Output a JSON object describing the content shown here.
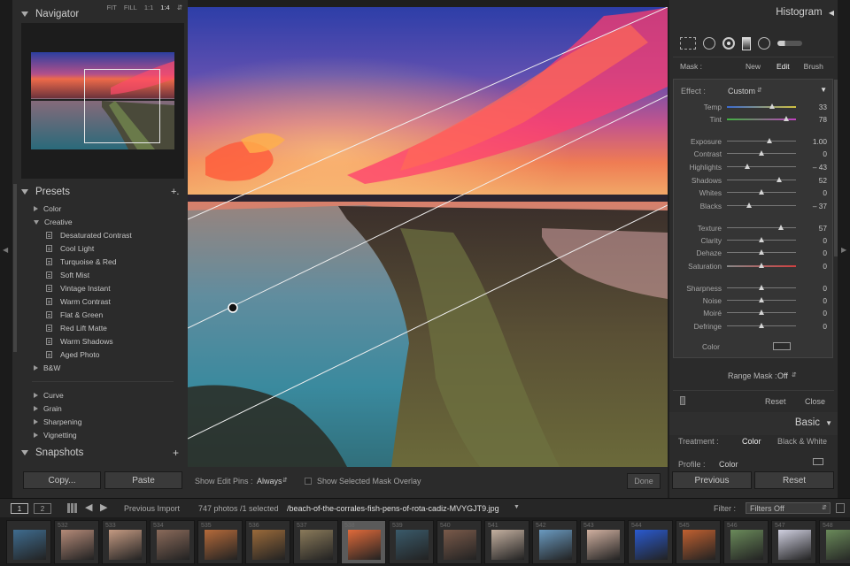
{
  "navigator": {
    "title": "Navigator",
    "zoom_options": [
      "FIT",
      "FILL",
      "1:1",
      "1:4"
    ],
    "selected_zoom": "1:4"
  },
  "presets": {
    "title": "Presets",
    "add": "+.",
    "folders": [
      {
        "label": "Color",
        "expanded": false
      },
      {
        "label": "Creative",
        "expanded": true
      },
      {
        "label": "B&W",
        "expanded": false
      }
    ],
    "creative_items": [
      "Desaturated Contrast",
      "Cool Light",
      "Turquoise & Red",
      "Soft Mist",
      "Vintage Instant",
      "Warm Contrast",
      "Flat & Green",
      "Red Lift Matte",
      "Warm Shadows",
      "Aged Photo"
    ],
    "groups": [
      "Curve",
      "Grain",
      "Sharpening",
      "Vignetting"
    ]
  },
  "snapshots": {
    "title": "Snapshots",
    "add": "+"
  },
  "left_buttons": {
    "copy": "Copy...",
    "paste": "Paste"
  },
  "toolbar": {
    "pins_label": "Show Edit Pins :",
    "pins_value": "Always",
    "overlay_label": "Show Selected Mask Overlay",
    "done": "Done"
  },
  "histogram": {
    "title": "Histogram"
  },
  "mask": {
    "label": "Mask :",
    "new": "New",
    "edit": "Edit",
    "brush": "Brush"
  },
  "effect": {
    "label": "Effect :",
    "value": "Custom"
  },
  "sliders": [
    {
      "label": "Temp",
      "value": "33",
      "pos": 0.65,
      "kind": "temp"
    },
    {
      "label": "Tint",
      "value": "78",
      "pos": 0.86,
      "kind": "tint"
    },
    {
      "label": "Exposure",
      "value": "1.00",
      "pos": 0.62
    },
    {
      "label": "Contrast",
      "value": "0",
      "pos": 0.5
    },
    {
      "label": "Highlights",
      "value": "– 43",
      "pos": 0.29
    },
    {
      "label": "Shadows",
      "value": "52",
      "pos": 0.76
    },
    {
      "label": "Whites",
      "value": "0",
      "pos": 0.5
    },
    {
      "label": "Blacks",
      "value": "– 37",
      "pos": 0.32
    },
    {
      "label": "Texture",
      "value": "57",
      "pos": 0.78
    },
    {
      "label": "Clarity",
      "value": "0",
      "pos": 0.5
    },
    {
      "label": "Dehaze",
      "value": "0",
      "pos": 0.5
    },
    {
      "label": "Saturation",
      "value": "0",
      "pos": 0.5,
      "kind": "sat"
    },
    {
      "label": "Sharpness",
      "value": "0",
      "pos": 0.5
    },
    {
      "label": "Noise",
      "value": "0",
      "pos": 0.5
    },
    {
      "label": "Moiré",
      "value": "0",
      "pos": 0.5
    },
    {
      "label": "Defringe",
      "value": "0",
      "pos": 0.5
    }
  ],
  "color_label": "Color",
  "range_mask": {
    "label": "Range Mask :",
    "value": "Off"
  },
  "mask_buttons": {
    "reset": "Reset",
    "close": "Close"
  },
  "basic": {
    "title": "Basic",
    "treatment_label": "Treatment :",
    "color": "Color",
    "bw": "Black & White",
    "profile_label": "Profile :",
    "profile_value": "Color"
  },
  "right_buttons": {
    "previous": "Previous",
    "reset": "Reset"
  },
  "filmstrip_bar": {
    "screen1": "1",
    "screen2": "2",
    "source": "Previous Import",
    "count": "747 photos /1 selected",
    "filename": "/beach-of-the-corrales-fish-pens-of-rota-cadiz-MVYGJT9.jpg",
    "filter_label": "Filter :",
    "filter_value": "Filters Off"
  },
  "filmstrip": [
    {
      "num": "",
      "hue": "#3f6c8f"
    },
    {
      "num": "532",
      "hue": "#b48a78"
    },
    {
      "num": "533",
      "hue": "#c49a82"
    },
    {
      "num": "534",
      "hue": "#8a6a5a"
    },
    {
      "num": "535",
      "hue": "#b56a3a"
    },
    {
      "num": "536",
      "hue": "#9a6a3a"
    },
    {
      "num": "537",
      "hue": "#8a7a5a"
    },
    {
      "num": "538",
      "hue": "#e06a3a",
      "active": true
    },
    {
      "num": "539",
      "hue": "#3a5a6a"
    },
    {
      "num": "540",
      "hue": "#7a5a4a"
    },
    {
      "num": "541",
      "hue": "#c4b0a0"
    },
    {
      "num": "542",
      "hue": "#6a9ac0"
    },
    {
      "num": "543",
      "hue": "#d0b0a0"
    },
    {
      "num": "544",
      "hue": "#2a5ad0"
    },
    {
      "num": "545",
      "hue": "#c06030"
    },
    {
      "num": "546",
      "hue": "#6a8a5a"
    },
    {
      "num": "547",
      "hue": "#d0d0e0"
    },
    {
      "num": "548",
      "hue": "#6a8a5a"
    }
  ]
}
